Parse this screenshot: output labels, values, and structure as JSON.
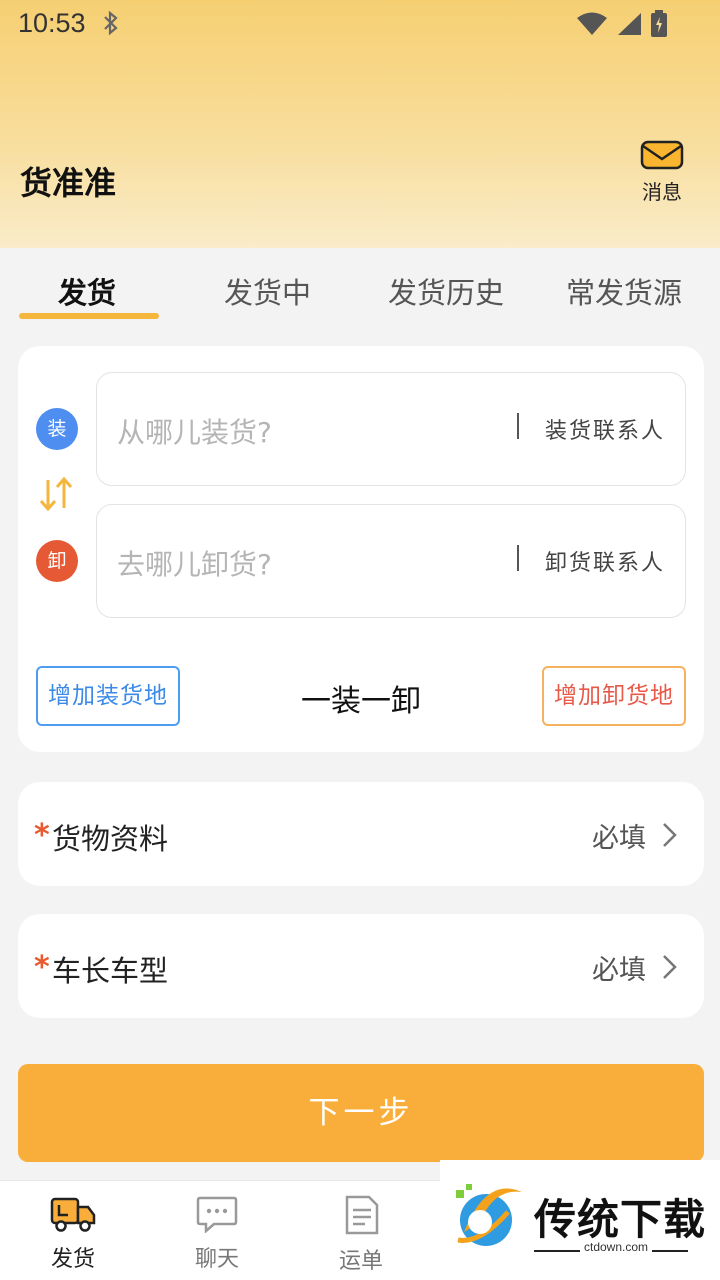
{
  "status_bar": {
    "time": "10:53"
  },
  "header": {
    "app_title": "货准准",
    "message_label": "消息"
  },
  "tabs": [
    {
      "label": "发货",
      "active": true
    },
    {
      "label": "发货中",
      "active": false
    },
    {
      "label": "发货历史",
      "active": false
    },
    {
      "label": "常发货源",
      "active": false
    }
  ],
  "address": {
    "load_badge": "装",
    "unload_badge": "卸",
    "load_placeholder": "从哪儿装货?",
    "unload_placeholder": "去哪儿卸货?",
    "load_contact": "装货联系人",
    "unload_contact": "卸货联系人",
    "add_load_label": "增加装货地",
    "add_unload_label": "增加卸货地",
    "mode_label": "一装一卸"
  },
  "fields": [
    {
      "label": "货物资料",
      "value": "必填",
      "required": true
    },
    {
      "label": "车长车型",
      "value": "必填",
      "required": true
    }
  ],
  "next_button": "下一步",
  "bottom_nav": [
    {
      "label": "发货",
      "icon": "truck-icon",
      "active": true
    },
    {
      "label": "聊天",
      "icon": "chat-icon",
      "active": false
    },
    {
      "label": "运单",
      "icon": "document-icon",
      "active": false
    }
  ],
  "watermark": {
    "text": "传统下载",
    "sub": "ctdown.com"
  },
  "colors": {
    "accent": "#f9ae3b",
    "load_blue": "#4d8ef0",
    "unload_red": "#e55a35"
  }
}
